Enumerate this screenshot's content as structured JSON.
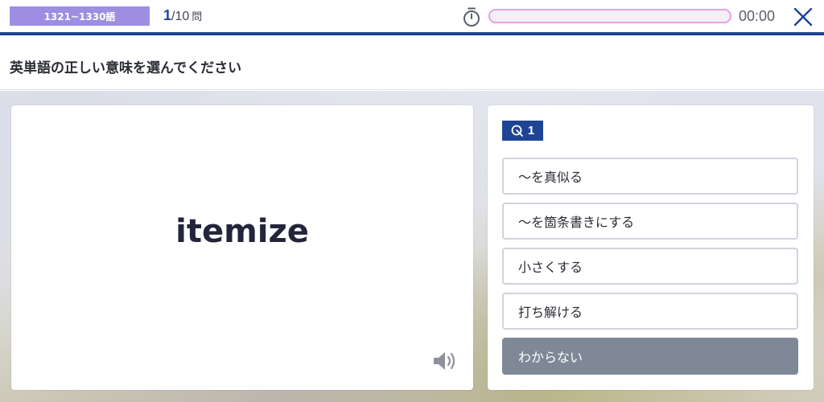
{
  "header": {
    "range_label": "1321~1330語",
    "question_current": "1",
    "question_total": "/10",
    "question_unit": "問",
    "progress": 0,
    "timer": "00:00",
    "colors": {
      "accent": "#1e4595",
      "badge": "#9d8ee2",
      "progress_border": "#ec9be8"
    }
  },
  "instruction": "英単語の正しい意味を選んでください",
  "question": {
    "word": "itemize",
    "audio_icon": "speaker-icon"
  },
  "answers": {
    "attempt_count": "1",
    "attempt_icon": "target-icon",
    "choices": [
      {
        "label": "〜を真似る"
      },
      {
        "label": "〜を箇条書きにする"
      },
      {
        "label": "小さくする"
      },
      {
        "label": "打ち解ける"
      }
    ],
    "dont_know_label": "わからない"
  }
}
